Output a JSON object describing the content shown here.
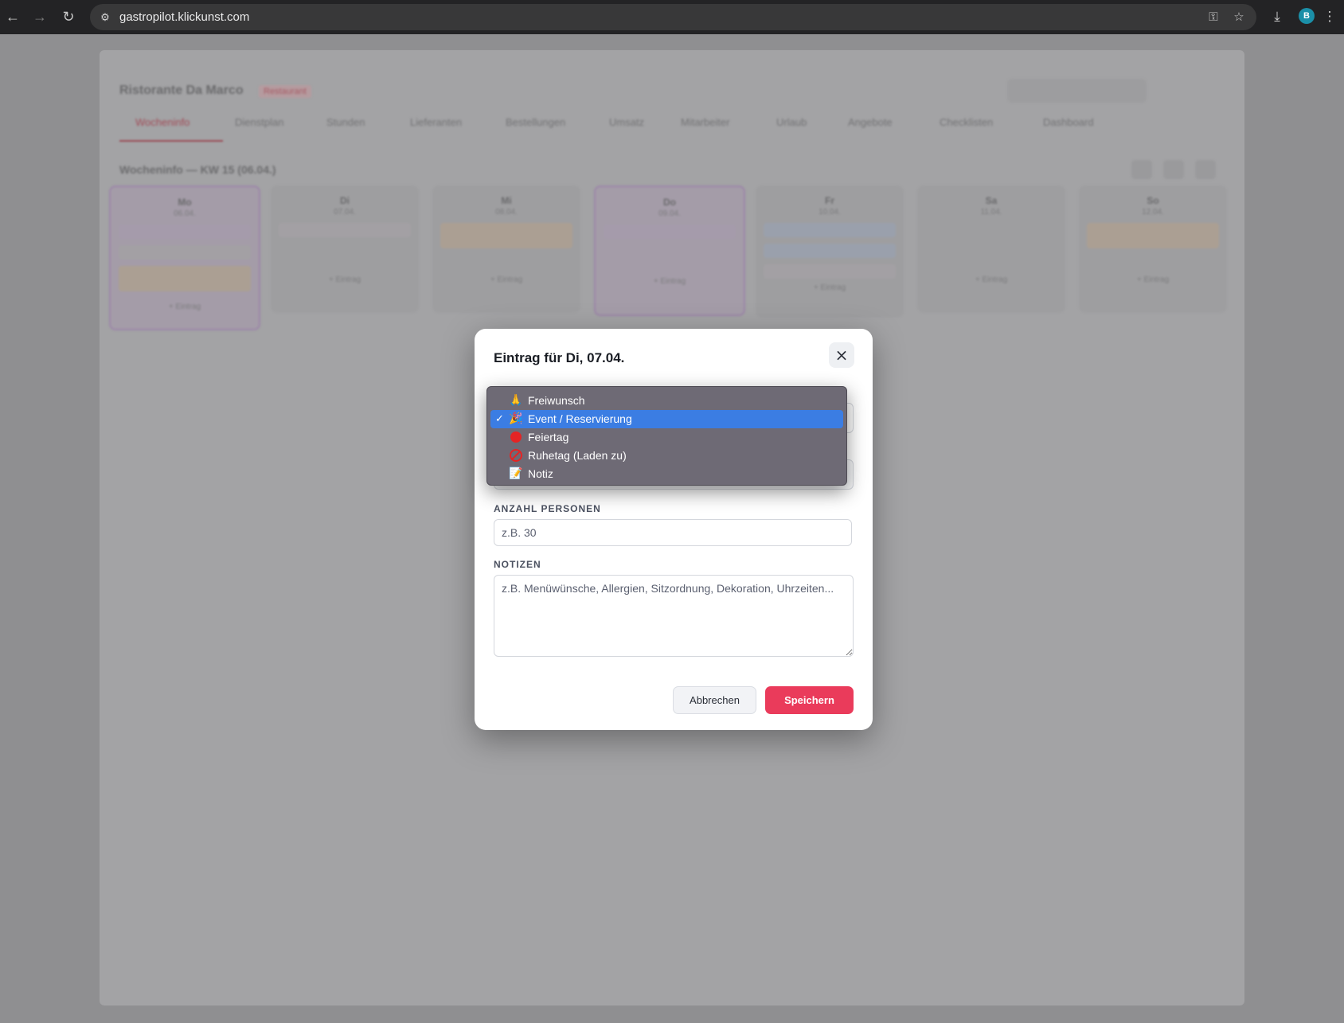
{
  "browser": {
    "url": "gastropilot.klickunst.com",
    "profile_initial": "B"
  },
  "background_page": {
    "restaurant_name": "Ristorante Da Marco",
    "badge": "Restaurant",
    "tabs": [
      "Wocheninfo",
      "Dienstplan",
      "Stunden",
      "Lieferanten",
      "Bestellungen",
      "Umsatz",
      "Mitarbeiter",
      "Urlaub",
      "Angebote",
      "Checklisten",
      "Dashboard"
    ],
    "week_title": "Wocheninfo — KW 15 (06.04.)",
    "days": [
      {
        "name": "Mo",
        "date": "06.04."
      },
      {
        "name": "Di",
        "date": "07.04."
      },
      {
        "name": "Mi",
        "date": "08.04."
      },
      {
        "name": "Do",
        "date": "09.04."
      },
      {
        "name": "Fr",
        "date": "10.04."
      },
      {
        "name": "Sa",
        "date": "11.04."
      },
      {
        "name": "So",
        "date": "12.04."
      }
    ],
    "add_entry_label": "+ Eintrag"
  },
  "modal": {
    "title": "Eintrag für Di, 07.04.",
    "close_icon": "×",
    "persons_label": "ANZAHL PERSONEN",
    "persons_placeholder": "z.B. 30",
    "notes_label": "NOTIZEN",
    "notes_placeholder": "z.B. Menüwünsche, Allergien, Sitzordnung, Dekoration, Uhrzeiten...",
    "cancel_label": "Abbrechen",
    "save_label": "Speichern",
    "accent_color": "#ea3b5b"
  },
  "dropdown": {
    "options": [
      {
        "emoji": "🙏",
        "label": "Freiwunsch",
        "selected": false
      },
      {
        "emoji": "🎉",
        "label": "Event / Reservierung",
        "selected": true
      },
      {
        "emoji": "red-circle",
        "label": "Feiertag",
        "selected": false
      },
      {
        "emoji": "no-entry",
        "label": "Ruhetag (Laden zu)",
        "selected": false
      },
      {
        "emoji": "📝",
        "label": "Notiz",
        "selected": false
      }
    ],
    "check_mark": "✓",
    "highlight_color": "#3b7de3"
  }
}
